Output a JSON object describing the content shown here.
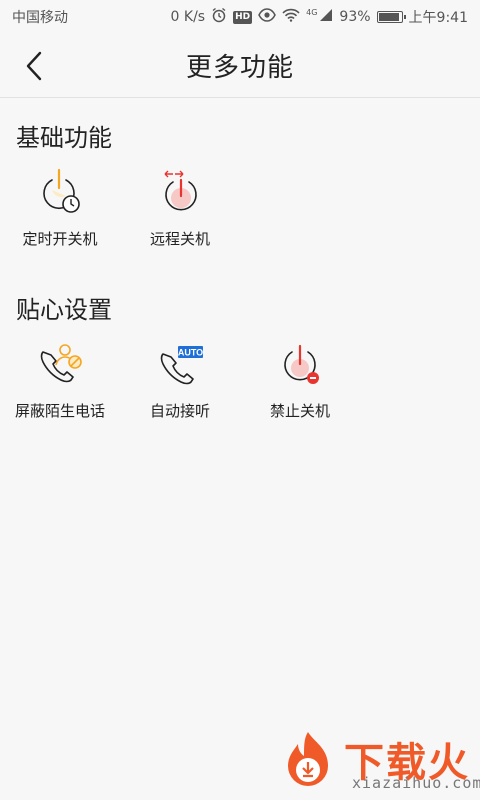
{
  "status_bar": {
    "carrier": "中国移动",
    "net_speed": "0 K/s",
    "hd_badge": "HD",
    "signal_type": "4G",
    "battery": "93%",
    "battery_level": 0.93,
    "time": "上午9:41",
    "icons": [
      "alarm-icon",
      "eye-icon",
      "wifi-icon",
      "signal-icon",
      "battery-icon"
    ]
  },
  "header": {
    "title": "更多功能",
    "back_icon": "chevron-left-icon"
  },
  "sections": [
    {
      "title": "基础功能",
      "items": [
        {
          "label": "定时开关机",
          "icon": "timed-power-icon"
        },
        {
          "label": "远程关机",
          "icon": "remote-shutdown-icon"
        }
      ]
    },
    {
      "title": "贴心设置",
      "items": [
        {
          "label": "屏蔽陌生电话",
          "icon": "block-stranger-call-icon"
        },
        {
          "label": "自动接听",
          "icon": "auto-answer-icon",
          "badge": "AUTO"
        },
        {
          "label": "禁止关机",
          "icon": "forbid-shutdown-icon"
        }
      ]
    }
  ],
  "watermark": {
    "brand": "下载火",
    "domain": "xiazaihuo.com"
  },
  "colors": {
    "accent_orange": "#f5a623",
    "power_red": "#e8352f",
    "auto_blue": "#1f6fd6",
    "watermark_orange": "#f05a28"
  }
}
